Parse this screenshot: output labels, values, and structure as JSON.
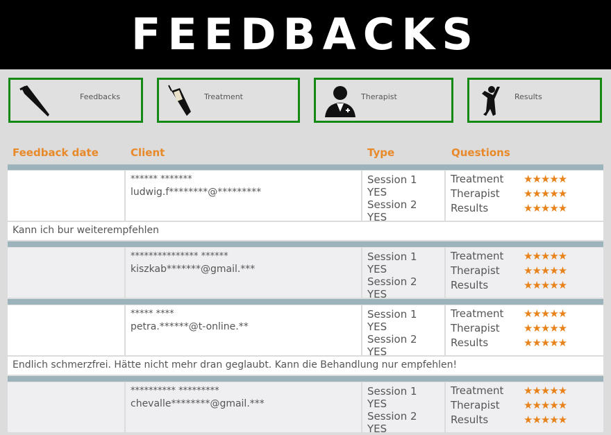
{
  "title": "FEEDBACKS",
  "nav": [
    {
      "label": "Feedbacks",
      "icon": "pen-icon"
    },
    {
      "label": "Treatment",
      "icon": "syringe-icon"
    },
    {
      "label": "Therapist",
      "icon": "doctor-icon"
    },
    {
      "label": "Results",
      "icon": "person-jumping-icon"
    }
  ],
  "columns": [
    "Feedback date",
    "Client",
    "Type",
    "Questions"
  ],
  "accent": "#e8892a",
  "rows": [
    {
      "date": "",
      "name": "****** *******",
      "email": "ludwig.f********@*********",
      "types": [
        "Session 1 YES",
        "Session 2 YES"
      ],
      "questions": [
        {
          "label": "Treatment",
          "stars": "★★★★★",
          "rating": 5
        },
        {
          "label": "Therapist",
          "stars": "★★★★★",
          "rating": 5
        },
        {
          "label": "Results",
          "stars": "★★★★★",
          "rating": 5
        }
      ],
      "comment": "Kann ich bur weiterempfehlen"
    },
    {
      "date": "",
      "name": "*************** ******",
      "email": "kiszkab*******@gmail.***",
      "types": [
        "Session 1 YES",
        "Session 2 YES"
      ],
      "questions": [
        {
          "label": "Treatment",
          "stars": "★★★★★",
          "rating": 5
        },
        {
          "label": "Therapist",
          "stars": "★★★★★",
          "rating": 5
        },
        {
          "label": "Results",
          "stars": "★★★★★",
          "rating": 5
        }
      ]
    },
    {
      "date": "",
      "name": "***** ****",
      "email": "petra.******@t-online.**",
      "types": [
        "Session 1 YES",
        "Session 2 YES"
      ],
      "questions": [
        {
          "label": "Treatment",
          "stars": "★★★★★",
          "rating": 5
        },
        {
          "label": "Therapist",
          "stars": "★★★★★",
          "rating": 5
        },
        {
          "label": "Results",
          "stars": "★★★★★",
          "rating": 5
        }
      ],
      "comment": "Endlich schmerzfrei. Hätte nicht mehr dran geglaubt. Kann die Behandlung nur empfehlen!"
    },
    {
      "date": "",
      "name": "********** *********",
      "email": "chevalle********@gmail.***",
      "types": [
        "Session 1 YES",
        "Session 2 YES"
      ],
      "questions": [
        {
          "label": "Treatment",
          "stars": "★★★★★",
          "rating": 5
        },
        {
          "label": "Therapist",
          "stars": "★★★★★",
          "rating": 5
        },
        {
          "label": "Results",
          "stars": "★★★★★",
          "rating": 5
        }
      ]
    }
  ]
}
